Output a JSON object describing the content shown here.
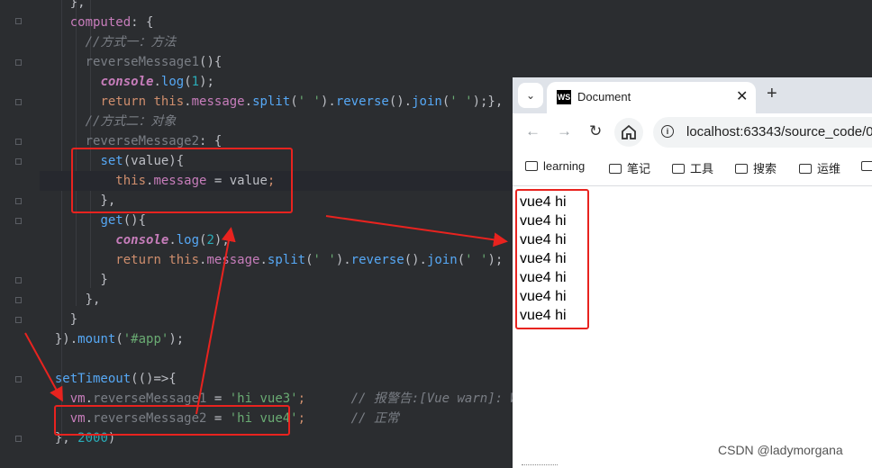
{
  "editor": {
    "lines": [
      {
        "parts": [
          [
            "d",
            "    },"
          ]
        ]
      },
      {
        "parts": [
          [
            "p",
            "    computed"
          ],
          [
            "d",
            ": {"
          ]
        ]
      },
      {
        "parts": [
          [
            "c",
            "      //方式一：方法"
          ]
        ]
      },
      {
        "parts": [
          [
            "cz",
            "      reverseMessage1"
          ],
          [
            "d",
            "(){"
          ]
        ]
      },
      {
        "parts": [
          [
            "d",
            "        "
          ],
          [
            "it",
            "console"
          ],
          [
            "d",
            "."
          ],
          [
            "f",
            "log"
          ],
          [
            "d",
            "("
          ],
          [
            "n",
            "1"
          ],
          [
            "d",
            ");"
          ]
        ]
      },
      {
        "parts": [
          [
            "d",
            "        "
          ],
          [
            "k",
            "return "
          ],
          [
            "k",
            "this"
          ],
          [
            "d",
            "."
          ],
          [
            "p",
            "message"
          ],
          [
            "d",
            "."
          ],
          [
            "f",
            "split"
          ],
          [
            "d",
            "("
          ],
          [
            "s",
            "' '"
          ],
          [
            "d",
            ")."
          ],
          [
            "f",
            "reverse"
          ],
          [
            "d",
            "()."
          ],
          [
            "f",
            "join"
          ],
          [
            "d",
            "("
          ],
          [
            "s",
            "' '"
          ],
          [
            "d",
            ");},"
          ]
        ]
      },
      {
        "parts": [
          [
            "c",
            "      //方式二：对象"
          ]
        ]
      },
      {
        "parts": [
          [
            "cz",
            "      reverseMessage2"
          ],
          [
            "d",
            ": {"
          ]
        ]
      },
      {
        "parts": [
          [
            "d",
            "        "
          ],
          [
            "f",
            "set"
          ],
          [
            "d",
            "(value){"
          ]
        ]
      },
      {
        "parts": [
          [
            "d",
            "          "
          ],
          [
            "k",
            "this"
          ],
          [
            "d",
            "."
          ],
          [
            "p",
            "message"
          ],
          [
            "d",
            " = value"
          ],
          [
            "k",
            ";"
          ]
        ]
      },
      {
        "parts": [
          [
            "d",
            "        },"
          ]
        ]
      },
      {
        "parts": [
          [
            "d",
            "        "
          ],
          [
            "f",
            "get"
          ],
          [
            "d",
            "(){"
          ]
        ]
      },
      {
        "parts": [
          [
            "d",
            "          "
          ],
          [
            "it",
            "console"
          ],
          [
            "d",
            "."
          ],
          [
            "f",
            "log"
          ],
          [
            "d",
            "("
          ],
          [
            "n",
            "2"
          ],
          [
            "d",
            ");"
          ]
        ]
      },
      {
        "parts": [
          [
            "d",
            "          "
          ],
          [
            "k",
            "return "
          ],
          [
            "k",
            "this"
          ],
          [
            "d",
            "."
          ],
          [
            "p",
            "message"
          ],
          [
            "d",
            "."
          ],
          [
            "f",
            "split"
          ],
          [
            "d",
            "("
          ],
          [
            "s",
            "' '"
          ],
          [
            "d",
            ")."
          ],
          [
            "f",
            "reverse"
          ],
          [
            "d",
            "()."
          ],
          [
            "f",
            "join"
          ],
          [
            "d",
            "("
          ],
          [
            "s",
            "' '"
          ],
          [
            "d",
            ");"
          ]
        ]
      },
      {
        "parts": [
          [
            "d",
            "        }"
          ]
        ]
      },
      {
        "parts": [
          [
            "d",
            "      },"
          ]
        ]
      },
      {
        "parts": [
          [
            "d",
            "    }"
          ]
        ]
      },
      {
        "parts": [
          [
            "d",
            "  })."
          ],
          [
            "f",
            "mount"
          ],
          [
            "d",
            "("
          ],
          [
            "s",
            "'#app'"
          ],
          [
            "d",
            ");"
          ]
        ]
      },
      {
        "parts": [
          [
            "d",
            ""
          ]
        ]
      },
      {
        "parts": [
          [
            "d",
            "  "
          ],
          [
            "f",
            "setTimeout"
          ],
          [
            "d",
            "(()=>{"
          ]
        ]
      },
      {
        "parts": [
          [
            "d",
            "    "
          ],
          [
            "p",
            "vm"
          ],
          [
            "d",
            "."
          ],
          [
            "cz",
            "reverseMessage1"
          ],
          [
            "d",
            " = "
          ],
          [
            "s",
            "'hi vue3'"
          ],
          [
            "k",
            ";"
          ],
          [
            "d",
            "      "
          ],
          [
            "c",
            "// 报警告:[Vue warn]: Wri"
          ]
        ]
      },
      {
        "parts": [
          [
            "d",
            "    "
          ],
          [
            "p",
            "vm"
          ],
          [
            "d",
            "."
          ],
          [
            "cz",
            "reverseMessage2"
          ],
          [
            "d",
            " = "
          ],
          [
            "s",
            "'hi vue4'"
          ],
          [
            "k",
            ";"
          ],
          [
            "d",
            "      "
          ],
          [
            "c",
            "// 正常"
          ]
        ]
      },
      {
        "parts": [
          [
            "d",
            "  }, "
          ],
          [
            "n",
            "2000"
          ],
          [
            "d",
            ")"
          ]
        ]
      }
    ]
  },
  "browser": {
    "tab_title": "Document",
    "tab_logo": "WS",
    "url": "localhost:63343/source_code/0",
    "bookmarks": [
      "learning",
      "笔记",
      "工具",
      "搜索",
      "运维",
      ""
    ],
    "output_lines": [
      "vue4 hi",
      "vue4 hi",
      "vue4 hi",
      "vue4 hi",
      "vue4 hi",
      "vue4 hi",
      "vue4 hi"
    ]
  },
  "watermark": "CSDN @ladymorgana",
  "icons": {
    "tab_list": "chevron-down-icon",
    "close": "close-icon",
    "new_tab": "plus-icon",
    "back": "arrow-left-icon",
    "forward": "arrow-right-icon",
    "reload": "reload-icon",
    "home": "home-icon",
    "site_info": "info-icon",
    "bookmark_folder": "folder-icon"
  },
  "colors": {
    "editor_bg": "#2b2d30",
    "annotation_red": "#e8231f",
    "keyword": "#cf8e6d",
    "string": "#6aab73",
    "function": "#56a8f5",
    "property": "#c77dbb",
    "number": "#2aacb8",
    "comment": "#7a7e85"
  }
}
